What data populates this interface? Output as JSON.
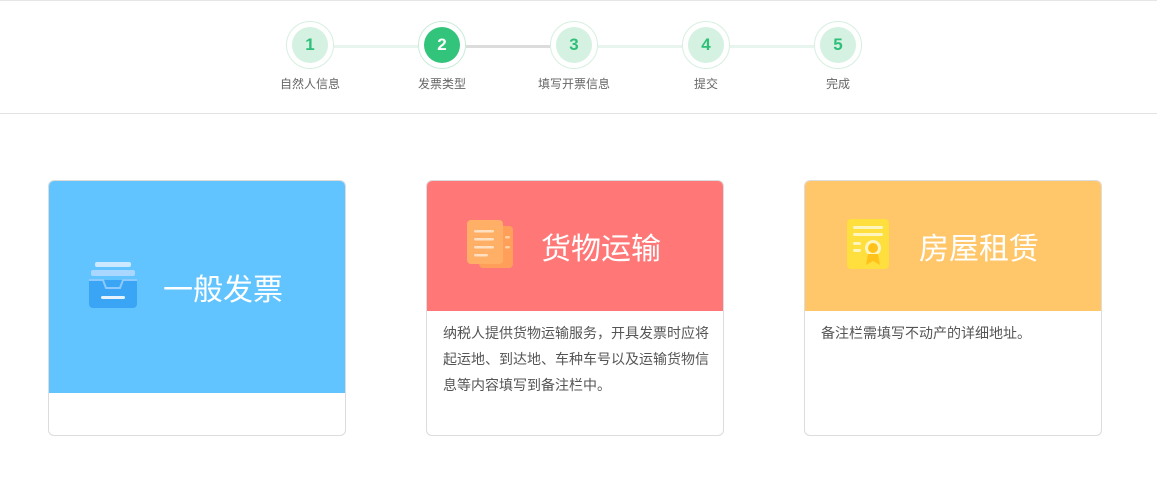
{
  "steps": [
    {
      "number": "1",
      "label": "自然人信息"
    },
    {
      "number": "2",
      "label": "发票类型"
    },
    {
      "number": "3",
      "label": "填写开票信息"
    },
    {
      "number": "4",
      "label": "提交"
    },
    {
      "number": "5",
      "label": "完成"
    }
  ],
  "active_step": "2",
  "cards": [
    {
      "title": "一般发票",
      "description": "",
      "icon": "invoice-tray-icon",
      "color": "#62c4ff"
    },
    {
      "title": "货物运输",
      "description": "纳税人提供货物运输服务，开具发票时应将起运地、到达地、车种车号以及运输货物信息等内容填写到备注栏中。",
      "icon": "documents-icon",
      "color": "#ff7877"
    },
    {
      "title": "房屋租赁",
      "description": "备注栏需填写不动产的详细地址。",
      "icon": "certificate-icon",
      "color": "#ffc76a"
    }
  ],
  "accent_color": "#33c47c"
}
